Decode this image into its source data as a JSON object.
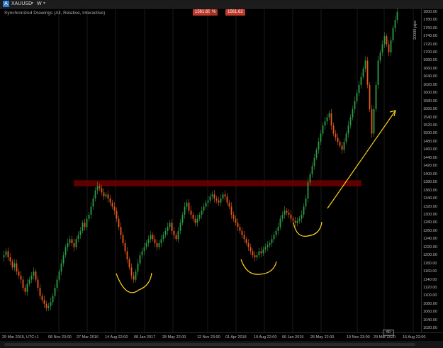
{
  "toolbar": {
    "symbol": "XAUUSD",
    "symbol_icon": "A",
    "timeframe": "W",
    "dropdown_icon": "chevron-down-icon"
  },
  "chart": {
    "subtitle": "Synchronized Drawings (All, Relative, Interactive)",
    "bid": "1561.60",
    "ask": "1561.62",
    "spread_icon": "%",
    "pips_label": "20000 pips",
    "zoom_label": "50"
  },
  "chart_data": {
    "type": "candlestick",
    "y_ticks": [
      "1800.00",
      "1780.00",
      "1760.00",
      "1740.00",
      "1720.00",
      "1700.00",
      "1680.00",
      "1660.00",
      "1640.00",
      "1620.00",
      "1600.00",
      "1580.00",
      "1560.00",
      "1540.00",
      "1520.00",
      "1500.00",
      "1480.00",
      "1460.00",
      "1440.00",
      "1420.00",
      "1400.00",
      "1380.00",
      "1360.00",
      "1340.00",
      "1320.00",
      "1300.00",
      "1280.00",
      "1260.00",
      "1240.00",
      "1220.00",
      "1200.00",
      "1180.00",
      "1160.00",
      "1140.00",
      "1120.00",
      "1100.00",
      "1080.00",
      "1060.00",
      "1040.00",
      "1020.00"
    ],
    "x_ticks": [
      "29 Mar 2015, UTC+1",
      "08 Nov 23:00",
      "27 Mar 2016",
      "14 Aug 22:00",
      "08 Jan 2017",
      "28 May 22:00",
      "12 Nov 23:00",
      "01 Apr 2018",
      "19 Aug 22:00",
      "06 Jan 2019",
      "26 May 22:00",
      "10 Nov 23:00",
      "29 Mar 2020",
      "16 Aug 22:00"
    ],
    "ylim": [
      1010,
      1810
    ],
    "resistance_zone": [
      1370,
      1385
    ],
    "colors": {
      "up": "#2e9d47",
      "down": "#e85a1c",
      "zone": "#6e0000",
      "annotation": "#ffd21a"
    },
    "closes": [
      1200,
      1210,
      1195,
      1185,
      1170,
      1180,
      1160,
      1150,
      1140,
      1120,
      1110,
      1130,
      1140,
      1150,
      1160,
      1140,
      1120,
      1100,
      1090,
      1080,
      1070,
      1075,
      1085,
      1100,
      1120,
      1140,
      1160,
      1180,
      1200,
      1220,
      1230,
      1240,
      1230,
      1220,
      1240,
      1250,
      1260,
      1280,
      1270,
      1290,
      1300,
      1320,
      1340,
      1360,
      1370,
      1365,
      1355,
      1345,
      1350,
      1340,
      1330,
      1320,
      1310,
      1290,
      1270,
      1250,
      1230,
      1210,
      1190,
      1170,
      1150,
      1140,
      1160,
      1180,
      1200,
      1210,
      1220,
      1230,
      1240,
      1250,
      1240,
      1230,
      1220,
      1230,
      1240,
      1250,
      1260,
      1270,
      1280,
      1260,
      1250,
      1240,
      1260,
      1280,
      1300,
      1320,
      1330,
      1310,
      1300,
      1290,
      1280,
      1290,
      1300,
      1310,
      1320,
      1330,
      1335,
      1345,
      1350,
      1340,
      1335,
      1330,
      1340,
      1350,
      1345,
      1330,
      1320,
      1300,
      1290,
      1280,
      1270,
      1260,
      1250,
      1240,
      1230,
      1220,
      1210,
      1200,
      1195,
      1200,
      1210,
      1205,
      1215,
      1220,
      1225,
      1230,
      1240,
      1250,
      1260,
      1270,
      1290,
      1300,
      1310,
      1305,
      1300,
      1290,
      1285,
      1280,
      1285,
      1290,
      1300,
      1320,
      1340,
      1380,
      1400,
      1420,
      1440,
      1460,
      1480,
      1500,
      1520,
      1530,
      1540,
      1550,
      1520,
      1500,
      1490,
      1480,
      1470,
      1460,
      1480,
      1500,
      1520,
      1540,
      1560,
      1580,
      1600,
      1620,
      1640,
      1660,
      1680,
      1620,
      1560,
      1500,
      1560,
      1620,
      1680,
      1700,
      1720,
      1740,
      1720,
      1700,
      1730,
      1760,
      1780,
      1800
    ]
  }
}
